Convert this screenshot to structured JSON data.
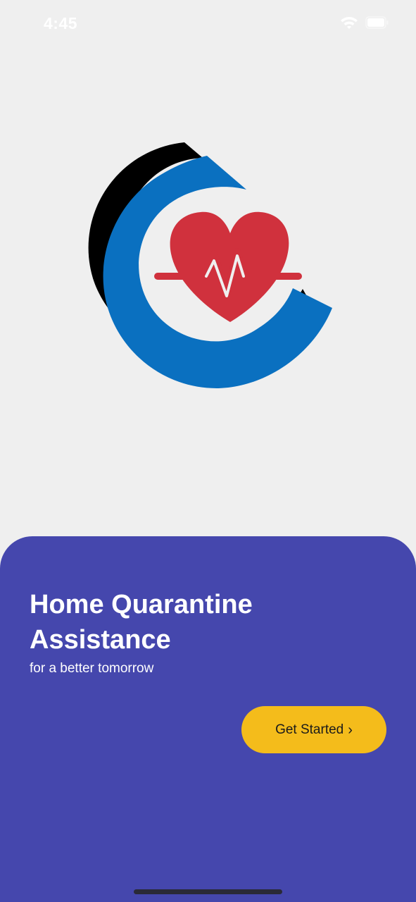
{
  "status_bar": {
    "time": "4:45",
    "icons": [
      "wifi-icon",
      "battery-icon"
    ]
  },
  "logo": {
    "icon": "heart-pulse-logo",
    "colors": {
      "shadow_arc": "#000000",
      "main_arc": "#0a70c0",
      "heart": "#d0313d"
    }
  },
  "onboarding": {
    "title": "Home Quarantine Assistance",
    "subtitle": "for a better tomorrow",
    "cta_label": "Get Started",
    "cta_icon": "chevron-right-icon"
  },
  "colors": {
    "background": "#efefef",
    "sheet": "#4547ad",
    "cta": "#f4bc1b"
  }
}
